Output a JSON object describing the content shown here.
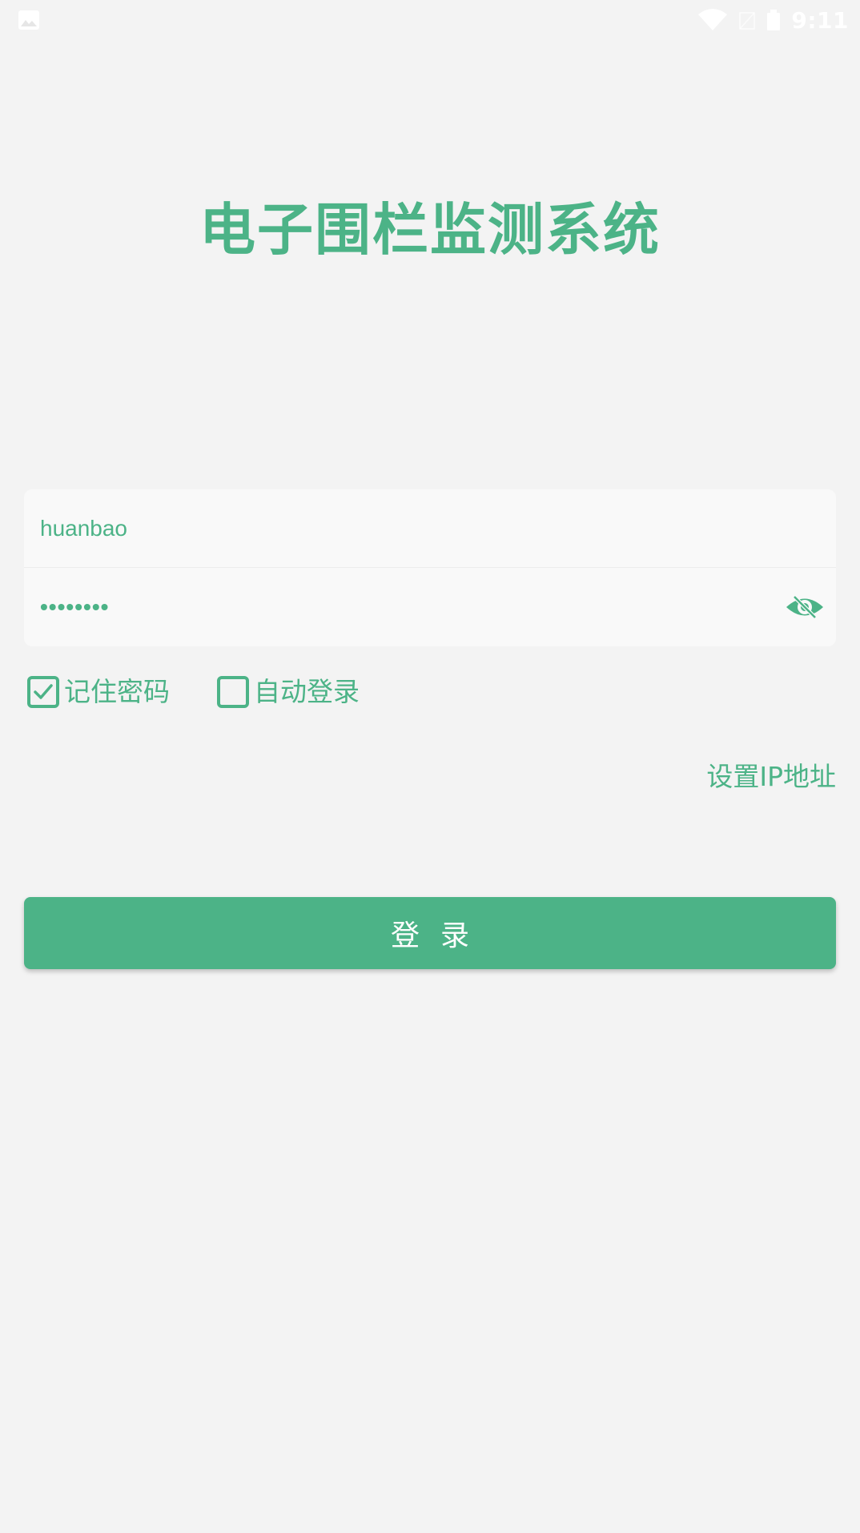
{
  "status_bar": {
    "time": "9:11",
    "icons": [
      "gallery-icon",
      "wifi-icon",
      "no-signal-icon",
      "battery-icon"
    ]
  },
  "app_title": "电子围栏监测系统",
  "form": {
    "username_value": "huanbao",
    "password_masked": "••••••••",
    "remember_password_label": "记住密码",
    "remember_password_checked": true,
    "auto_login_label": "自动登录",
    "auto_login_checked": false,
    "set_ip_label": "设置IP地址",
    "login_button_label": "登录"
  },
  "colors": {
    "accent": "#4cb387",
    "background": "#f3f3f3",
    "card": "#f9f9f9"
  }
}
